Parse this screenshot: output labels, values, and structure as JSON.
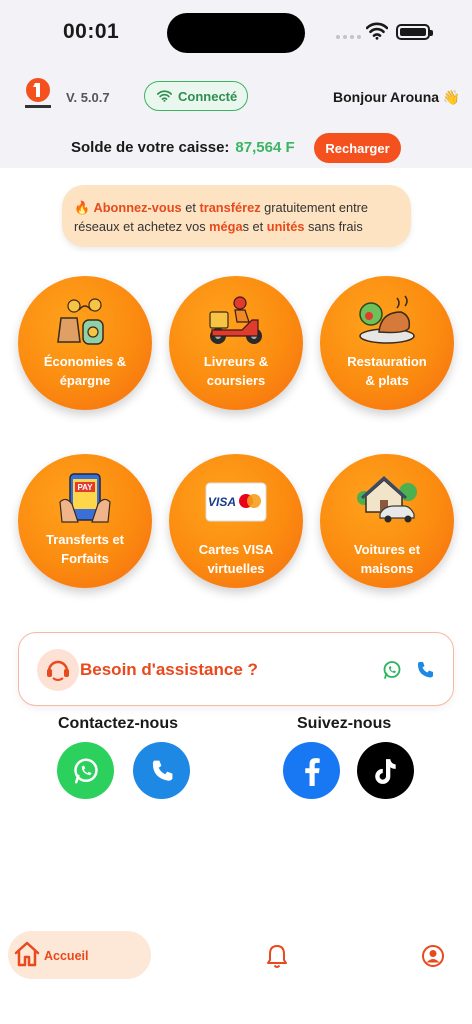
{
  "status_bar": {
    "time": "00:01"
  },
  "header": {
    "version": "V. 5.0.7",
    "connection": "Connecté",
    "greeting": "Bonjour Arouna 👋"
  },
  "balance": {
    "label": "Solde de votre caisse:",
    "amount": "87,564 F",
    "button": "Recharger"
  },
  "promo": {
    "icon": "🔥",
    "p1": "Abonnez-vous",
    "p2": " et ",
    "p3": "transférez",
    "p4": " gratuitement entre réseaux et achetez vos ",
    "p5": "méga",
    "p6": "s et ",
    "p7": "unités",
    "p8": " sans frais"
  },
  "services": [
    {
      "line1": "Économies &",
      "line2": "épargne",
      "icon": "piggy-savings-icon"
    },
    {
      "line1": "Livreurs &",
      "line2": "coursiers",
      "icon": "delivery-scooter-icon"
    },
    {
      "line1": "Restauration",
      "line2": "& plats",
      "icon": "food-plate-icon"
    },
    {
      "line1": "Transferts et",
      "line2": "Forfaits",
      "icon": "phone-pay-icon"
    },
    {
      "line1": "Cartes VISA",
      "line2": "virtuelles",
      "icon": "visa-card-icon"
    },
    {
      "line1": "Voitures et",
      "line2": "maisons",
      "icon": "house-car-icon"
    }
  ],
  "assistance": {
    "title": "Besoin d'assistance ?"
  },
  "contact": {
    "title": "Contactez-nous"
  },
  "follow": {
    "title": "Suivez-nous"
  },
  "tabbar": {
    "home": "Accueil"
  },
  "colors": {
    "accent": "#f4511e",
    "green": "#3bb561",
    "tile": "#fb8b10",
    "whatsapp": "#2bd15c",
    "phone": "#1e88e5",
    "facebook": "#1877f2"
  }
}
